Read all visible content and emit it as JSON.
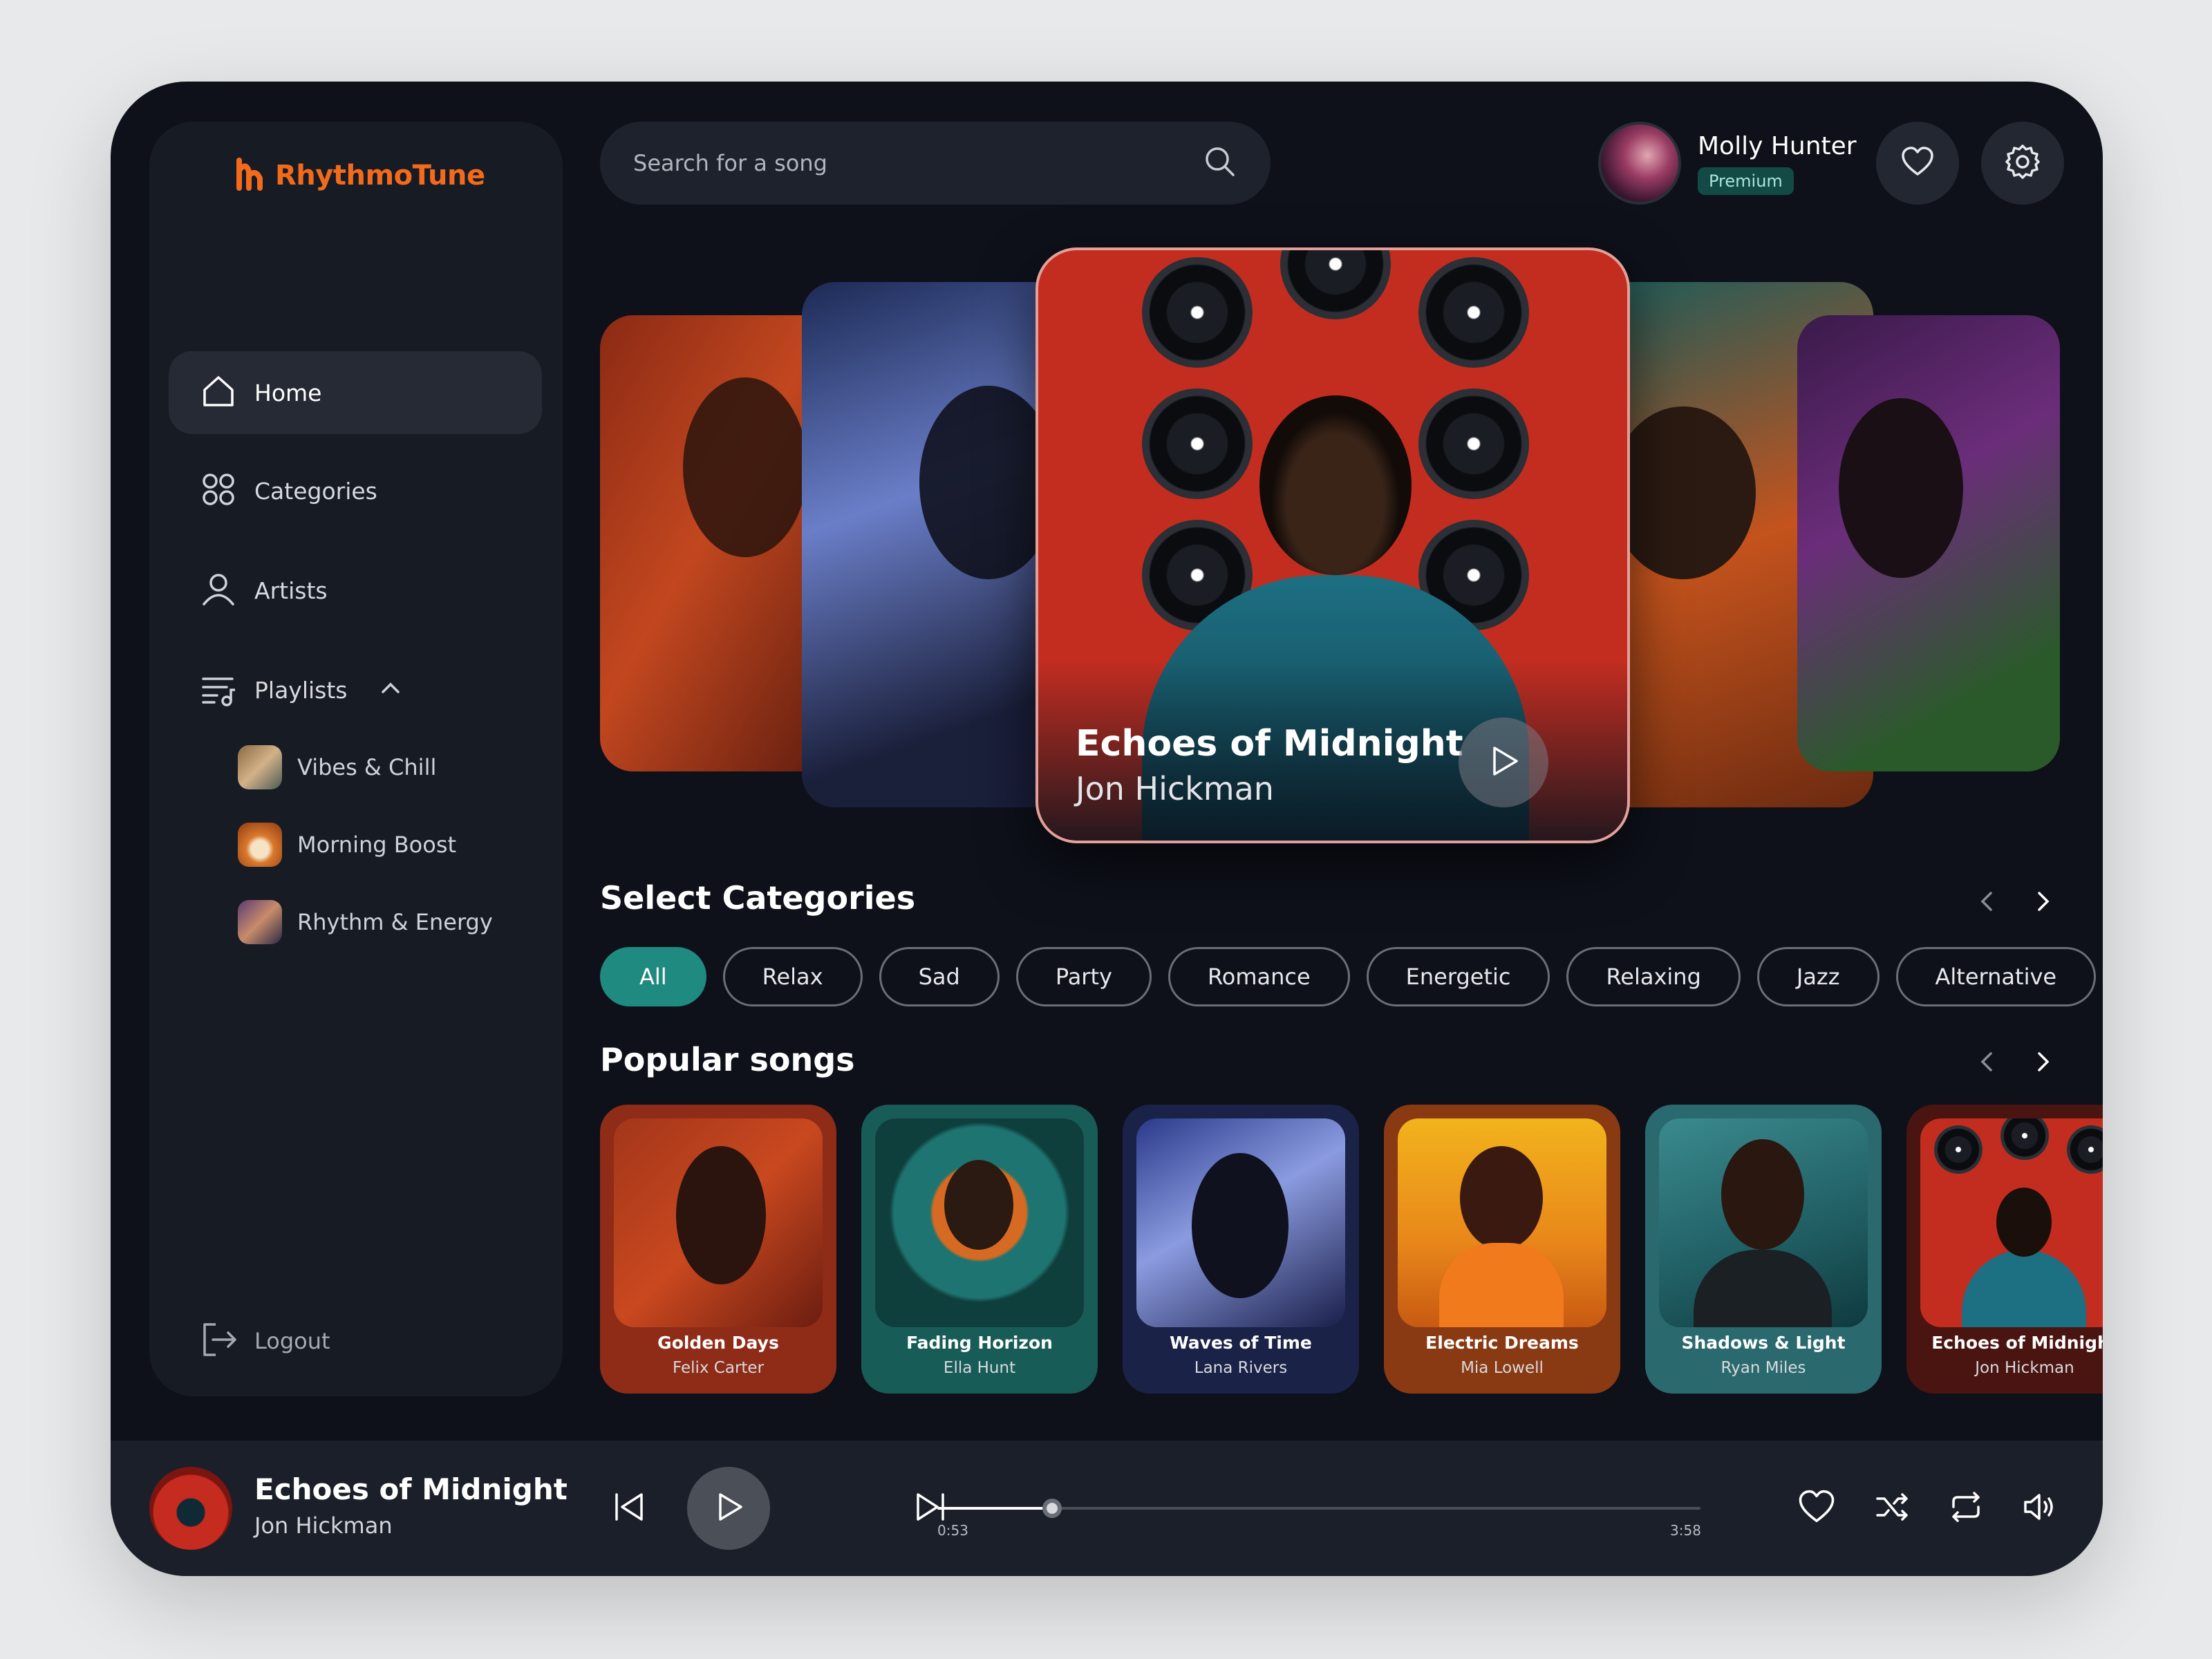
{
  "app": {
    "name": "RhythmoTune"
  },
  "nav": {
    "home": "Home",
    "categories": "Categories",
    "artists": "Artists",
    "playlists": "Playlists",
    "logout": "Logout"
  },
  "playlists": [
    {
      "label": "Vibes & Chill"
    },
    {
      "label": "Morning Boost"
    },
    {
      "label": "Rhythm & Energy"
    }
  ],
  "search": {
    "placeholder": "Search for a song"
  },
  "user": {
    "name": "Molly Hunter",
    "plan": "Premium"
  },
  "featured": {
    "title": "Echoes of Midnight",
    "artist": "Jon Hickman"
  },
  "categories_section": {
    "title": "Select Categories",
    "chips": [
      "All",
      "Relax",
      "Sad",
      "Party",
      "Romance",
      "Energetic",
      "Relaxing",
      "Jazz",
      "Alternative"
    ],
    "selected": "All"
  },
  "popular_section": {
    "title": "Popular songs",
    "songs": [
      {
        "title": "Golden Days",
        "artist": "Felix Carter"
      },
      {
        "title": "Fading Horizon",
        "artist": "Ella Hunt"
      },
      {
        "title": "Waves of Time",
        "artist": "Lana Rivers"
      },
      {
        "title": "Electric Dreams",
        "artist": "Mia Lowell"
      },
      {
        "title": "Shadows & Light",
        "artist": "Ryan Miles"
      },
      {
        "title": "Echoes of Midnight",
        "artist": "Jon Hickman"
      }
    ]
  },
  "player": {
    "title": "Echoes of Midnight",
    "artist": "Jon Hickman",
    "elapsed": "0:53",
    "duration": "3:58",
    "progress_fraction": 0.15
  },
  "colors": {
    "accent_orange": "#f26a1b",
    "accent_teal": "#1f8a80",
    "background": "#0e111a",
    "panel": "#171b24"
  }
}
